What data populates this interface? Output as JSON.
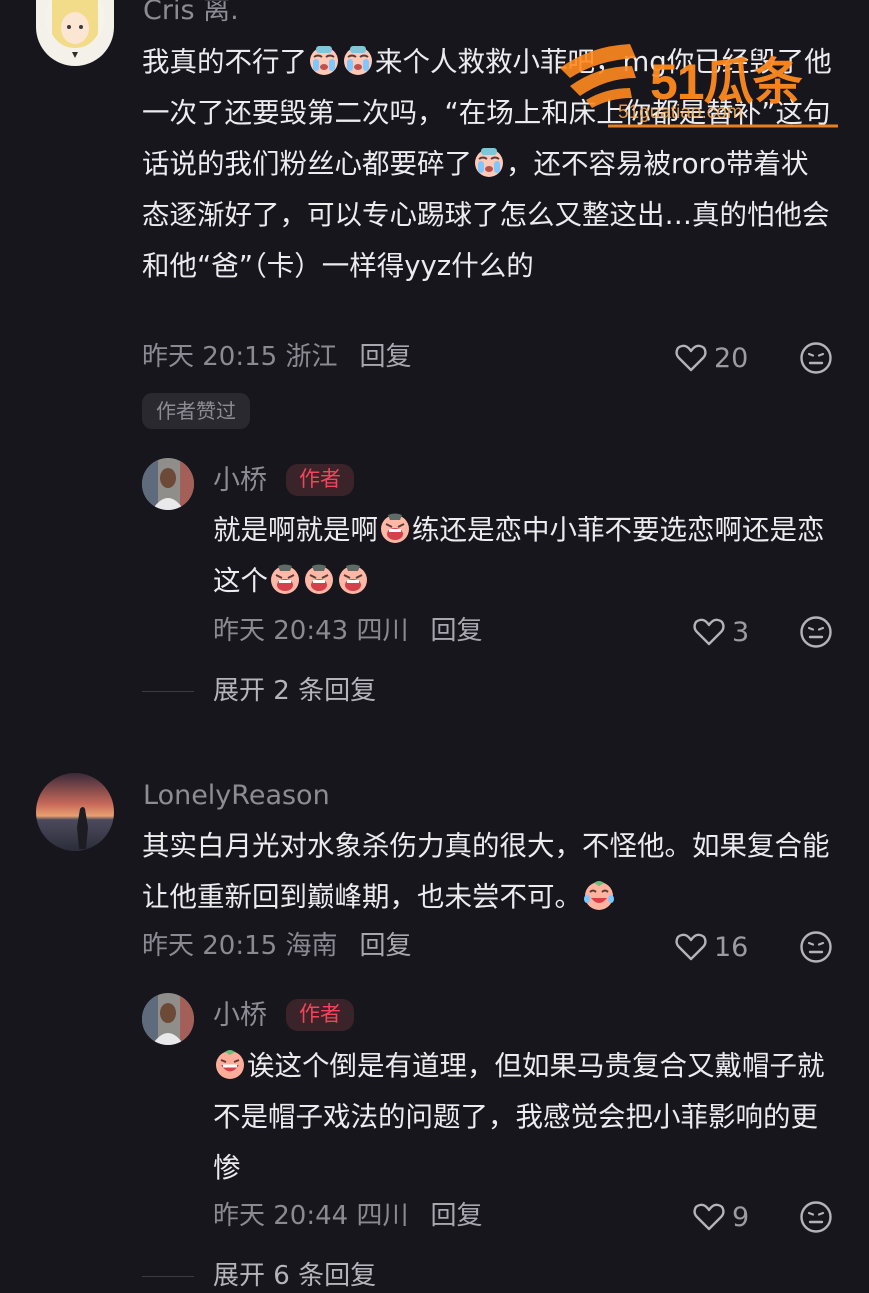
{
  "watermark": {
    "brand": "51瓜条",
    "url": "51guatiao.com"
  },
  "comments": [
    {
      "user": "Cris 离.",
      "text_segments": [
        "我真的不行了",
        "来个人救救小菲吧，mg你已经毁了他一次了还要毁第二次吗，“在场上和床上你都是替补”这句话说的我们粉丝心都要碎了",
        "，还不容易被roro带着状态逐渐好了，可以专心踢球了怎么又整这出…真的怕他会和他“爸”（卡）一样得yyz什么的"
      ],
      "time": "昨天 20:15 浙江",
      "reply": "回复",
      "likes": "20",
      "author_liked": "作者赞过",
      "reply_item": {
        "user": "小桥",
        "badge": "作者",
        "text_segments": [
          "就是啊就是啊",
          "练还是恋中小菲不要选恋啊还是恋这个"
        ],
        "time": "昨天 20:43 四川",
        "reply": "回复",
        "likes": "3"
      },
      "expand": "展开 2 条回复"
    },
    {
      "user": "LonelyReason",
      "text_segments": [
        "其实白月光对水象杀伤力真的很大，不怪他。如果复合能让他重新回到巅峰期，也未尝不可。"
      ],
      "time": "昨天 20:15 海南",
      "reply": "回复",
      "likes": "16",
      "reply_item": {
        "user": "小桥",
        "badge": "作者",
        "text_segments": [
          "诶这个倒是有道理，但如果马贵复合又戴帽子就不是帽子戏法的问题了，我感觉会把小菲影响的更惨"
        ],
        "time": "昨天 20:44 四川",
        "reply": "回复",
        "likes": "9"
      },
      "expand": "展开 6 条回复"
    }
  ]
}
